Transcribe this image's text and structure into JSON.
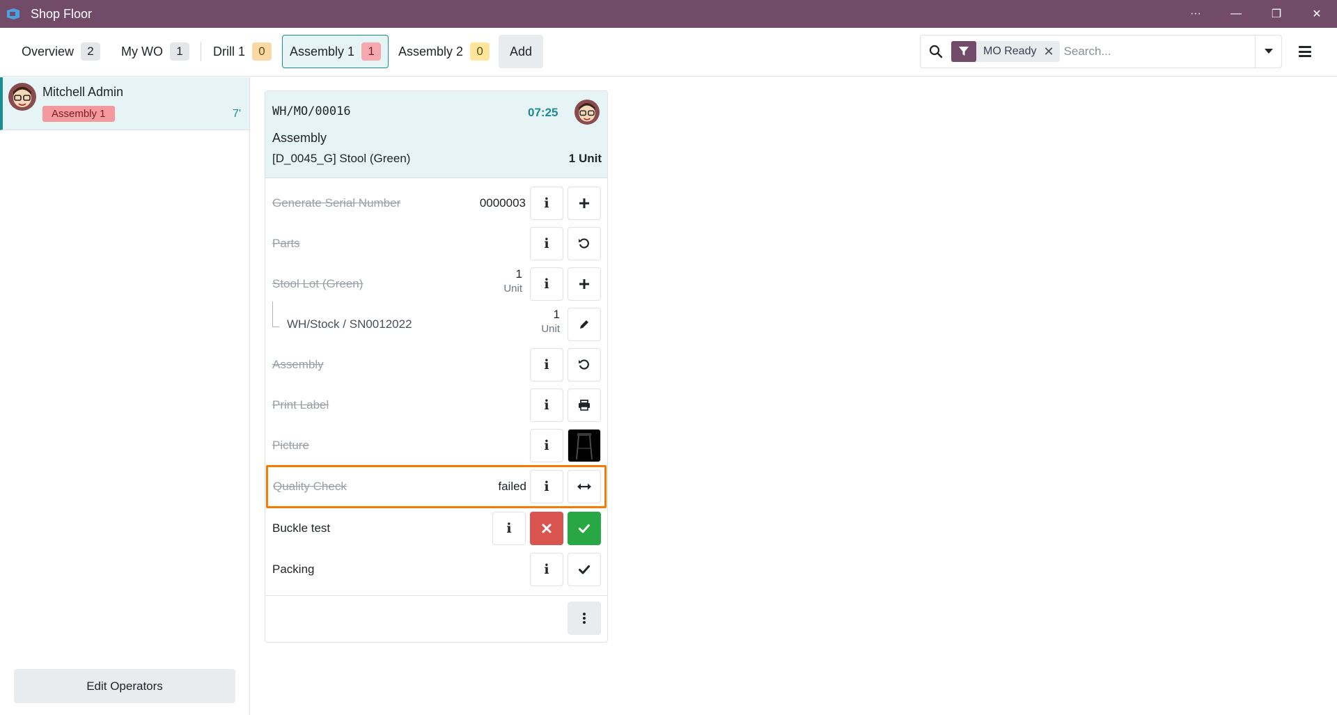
{
  "window": {
    "title": "Shop Floor",
    "controls": [
      "···",
      "—",
      "❐",
      "✕"
    ]
  },
  "nav": {
    "tabs": [
      {
        "label": "Overview",
        "count": "2"
      },
      {
        "label": "My WO",
        "count": "1"
      },
      {
        "label": "Drill 1",
        "count": "0"
      },
      {
        "label": "Assembly 1",
        "count": "1"
      },
      {
        "label": "Assembly 2",
        "count": "0"
      }
    ],
    "add_label": "Add",
    "active_tab": "Assembly 1"
  },
  "search": {
    "facet_label": "MO Ready",
    "placeholder": "Search...",
    "facet_close": "✕"
  },
  "sidebar": {
    "operator_name": "Mitchell Admin",
    "operator_workcenter": "Assembly 1",
    "operator_time": "7'",
    "edit_operators_label": "Edit Operators"
  },
  "workorder": {
    "name": "WH/MO/00016",
    "time": "07:25",
    "operation": "Assembly",
    "product": "[D_0045_G] Stool (Green)",
    "quantity": "1 Unit",
    "steps": [
      {
        "label": "Generate Serial Number",
        "value": "0000003",
        "action_icon": "plus-icon"
      },
      {
        "label": "Parts",
        "action_icon": "undo-icon"
      },
      {
        "label": "Stool Lot (Green)",
        "qty": "1",
        "unit": "Unit",
        "action_icon": "plus-icon"
      },
      {
        "label": "WH/Stock / SN0012022",
        "qty": "1",
        "unit": "Unit",
        "action_icon": "pencil-icon"
      },
      {
        "label": "Assembly",
        "action_icon": "undo-icon"
      },
      {
        "label": "Print Label",
        "action_icon": "printer-icon"
      },
      {
        "label": "Picture",
        "action_icon": "picture-thumbnail"
      },
      {
        "label": "Quality Check",
        "status": "failed",
        "action_icon": "swap-arrows-icon"
      },
      {
        "label": "Buckle test",
        "action_icon": "fail-pass-buttons"
      },
      {
        "label": "Packing",
        "action_icon": "check-icon"
      }
    ]
  },
  "colors": {
    "brand": "#714B67",
    "accent": "#1b8c92",
    "danger": "#d9534f",
    "success": "#28a745",
    "highlight": "#f57c00"
  }
}
